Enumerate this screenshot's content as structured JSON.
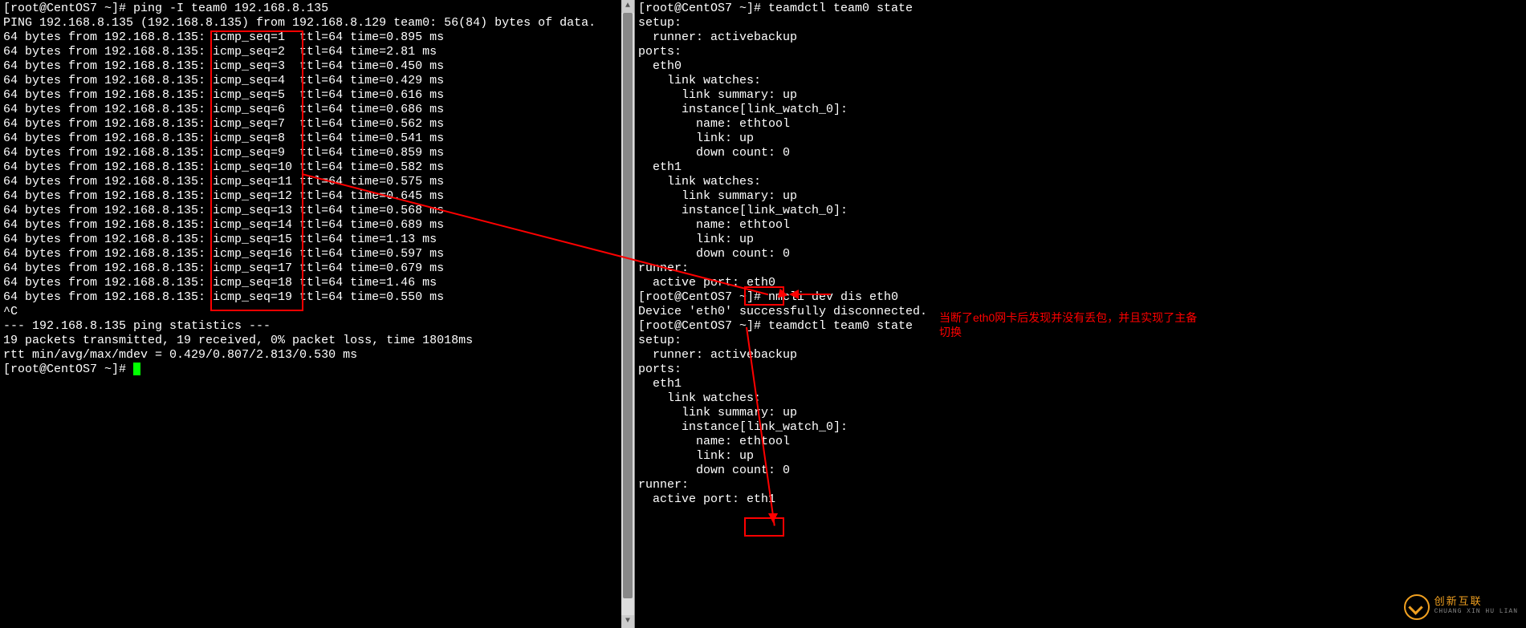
{
  "left": {
    "prompt_user": "root",
    "prompt_host": "CentOS7",
    "prompt_dir": "~",
    "command": "ping -I team0 192.168.8.135",
    "ping_header": "PING 192.168.8.135 (192.168.8.135) from 192.168.8.129 team0: 56(84) bytes of data.",
    "replies": [
      {
        "seq": "1",
        "ttl": "64",
        "time": "0.895"
      },
      {
        "seq": "2",
        "ttl": "64",
        "time": "2.81"
      },
      {
        "seq": "3",
        "ttl": "64",
        "time": "0.450"
      },
      {
        "seq": "4",
        "ttl": "64",
        "time": "0.429"
      },
      {
        "seq": "5",
        "ttl": "64",
        "time": "0.616"
      },
      {
        "seq": "6",
        "ttl": "64",
        "time": "0.686"
      },
      {
        "seq": "7",
        "ttl": "64",
        "time": "0.562"
      },
      {
        "seq": "8",
        "ttl": "64",
        "time": "0.541"
      },
      {
        "seq": "9",
        "ttl": "64",
        "time": "0.859"
      },
      {
        "seq": "10",
        "ttl": "64",
        "time": "0.582"
      },
      {
        "seq": "11",
        "ttl": "64",
        "time": "0.575"
      },
      {
        "seq": "12",
        "ttl": "64",
        "time": "0.645"
      },
      {
        "seq": "13",
        "ttl": "64",
        "time": "0.568"
      },
      {
        "seq": "14",
        "ttl": "64",
        "time": "0.689"
      },
      {
        "seq": "15",
        "ttl": "64",
        "time": "1.13"
      },
      {
        "seq": "16",
        "ttl": "64",
        "time": "0.597"
      },
      {
        "seq": "17",
        "ttl": "64",
        "time": "0.679"
      },
      {
        "seq": "18",
        "ttl": "64",
        "time": "1.46"
      },
      {
        "seq": "19",
        "ttl": "64",
        "time": "0.550"
      }
    ],
    "reply_prefix": "64 bytes from 192.168.8.135:",
    "interrupt": "^C",
    "stats_header": "--- 192.168.8.135 ping statistics ---",
    "stats_line1": "19 packets transmitted, 19 received, 0% packet loss, time 18018ms",
    "stats_line2": "rtt min/avg/max/mdev = 0.429/0.807/2.813/0.530 ms",
    "final_prompt": "[root@CentOS7 ~]# "
  },
  "right": {
    "cmd1_prompt": "[root@CentOS7 ~]# ",
    "cmd1": "teamdctl team0 state",
    "state1": {
      "setup": "setup:",
      "runner": "  runner: activebackup",
      "ports": "ports:",
      "eth0": "  eth0",
      "eth0_lw": "    link watches:",
      "eth0_sum": "      link summary: up",
      "eth0_inst": "      instance[link_watch_0]:",
      "eth0_name": "        name: ethtool",
      "eth0_link": "        link: up",
      "eth0_down": "        down count: 0",
      "eth1": "  eth1",
      "eth1_lw": "    link watches:",
      "eth1_sum": "      link summary: up",
      "eth1_inst": "      instance[link_watch_0]:",
      "eth1_name": "        name: ethtool",
      "eth1_link": "        link: up",
      "eth1_down": "        down count: 0",
      "runner_label": "runner:",
      "active_port_label": "  active port: ",
      "active_port": "eth0"
    },
    "cmd2_prompt": "[root@CentOS7 ~]# ",
    "cmd2": "nmcli dev dis eth0",
    "cmd2_out": "Device 'eth0' successfully disconnected.",
    "cmd3_prompt": "[root@CentOS7 ~]# ",
    "cmd3": "teamdctl team0 state",
    "state2": {
      "setup": "setup:",
      "runner": "  runner: activebackup",
      "ports": "ports:",
      "eth1": "  eth1",
      "eth1_lw": "    link watches:",
      "eth1_sum": "      link summary: up",
      "eth1_inst": "      instance[link_watch_0]:",
      "eth1_name": "        name: ethtool",
      "eth1_link": "        link: up",
      "eth1_down": "        down count: 0",
      "runner_label": "runner:",
      "active_port_label": "  active port: ",
      "active_port": "eth1"
    }
  },
  "annotation": {
    "line1": "当断了eth0网卡后发现并没有丢包，并且实现了主备",
    "line2": "切换"
  },
  "logo": {
    "cn": "创新互联",
    "en": "CHUANG XIN HU LIAN"
  }
}
